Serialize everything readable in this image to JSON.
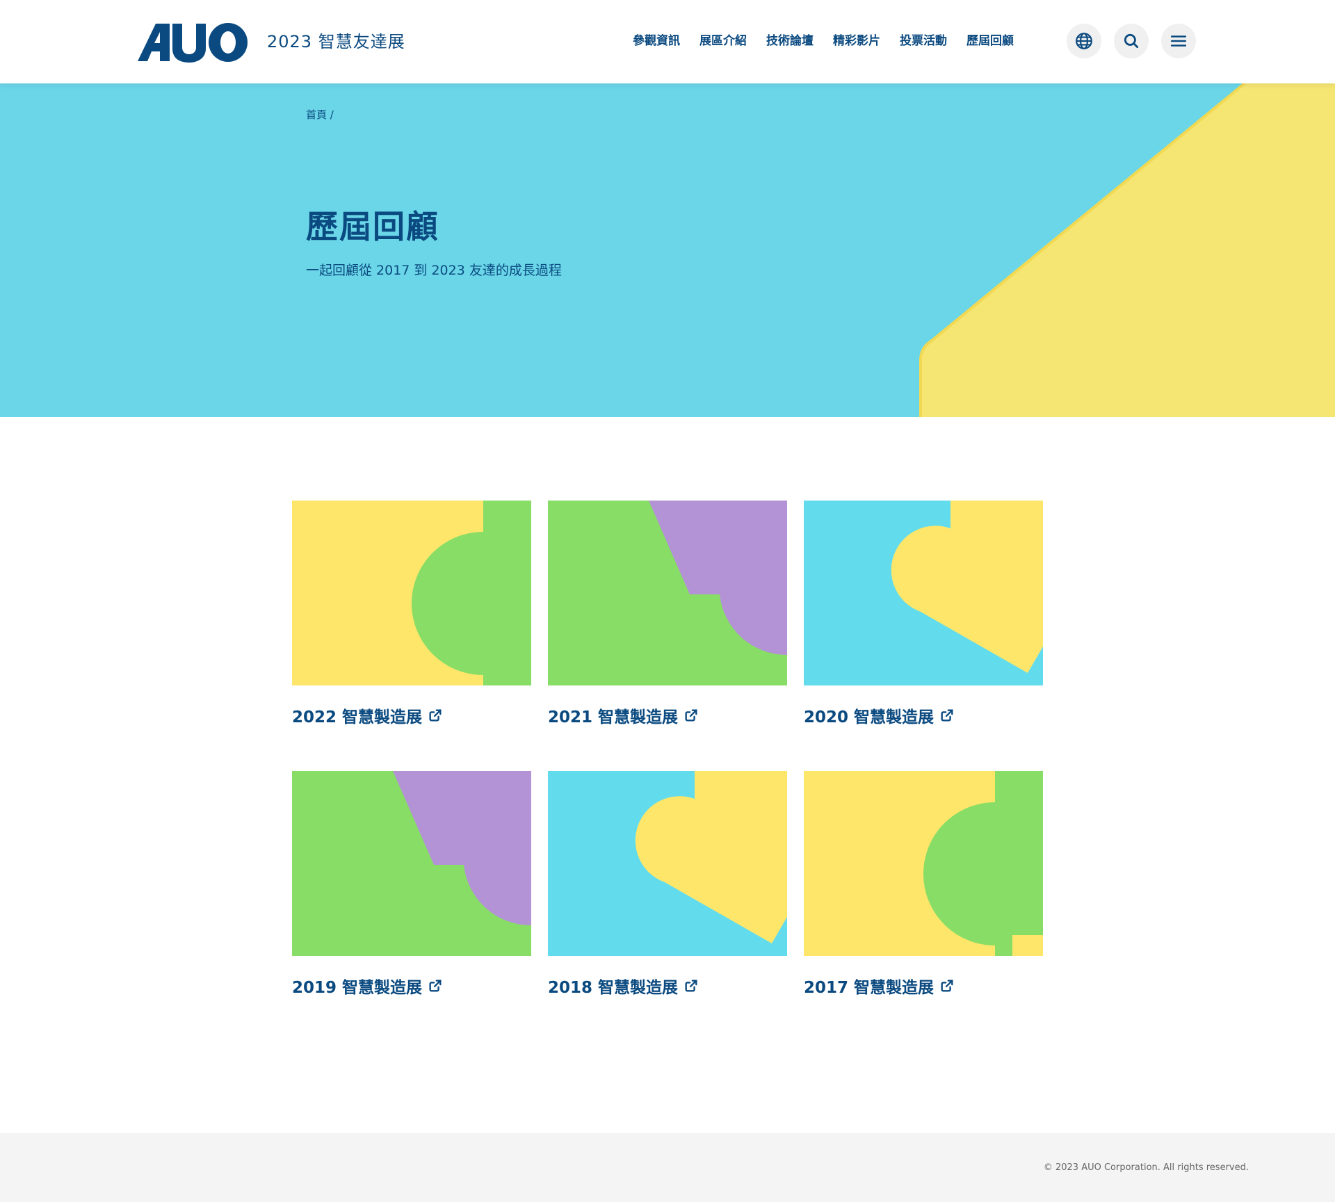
{
  "header": {
    "logo_text": "AUO",
    "site_title": "2023 智慧友達展",
    "nav": [
      "參觀資訊",
      "展區介紹",
      "技術論壇",
      "精彩影片",
      "投票活動",
      "歷屆回顧"
    ],
    "icons": [
      "globe-icon",
      "search-icon",
      "menu-icon"
    ]
  },
  "hero": {
    "breadcrumb": "首頁 /",
    "title": "歷屆回顧",
    "subtitle": "一起回顧從 2017 到 2023 友達的成長過程",
    "colors": {
      "background": "#63d4e8",
      "accent": "#f5e36a"
    }
  },
  "gallery": [
    {
      "label": "2022 智慧製造展",
      "theme": "yellow-green"
    },
    {
      "label": "2021 智慧製造展",
      "theme": "green-purple"
    },
    {
      "label": "2020 智慧製造展",
      "theme": "blue-yellow"
    },
    {
      "label": "2019 智慧製造展",
      "theme": "green-purple"
    },
    {
      "label": "2018 智慧製造展",
      "theme": "blue-yellow"
    },
    {
      "label": "2017 智慧製造展",
      "theme": "yellow-green"
    }
  ],
  "footer": {
    "copyright": "© 2023 AUO Corporation. All rights reserved."
  },
  "palette": {
    "primary": "#0b4a80",
    "yellow": "#fee66a",
    "green": "#88dd66",
    "purple": "#b392d6",
    "cyan": "#62dcec"
  }
}
